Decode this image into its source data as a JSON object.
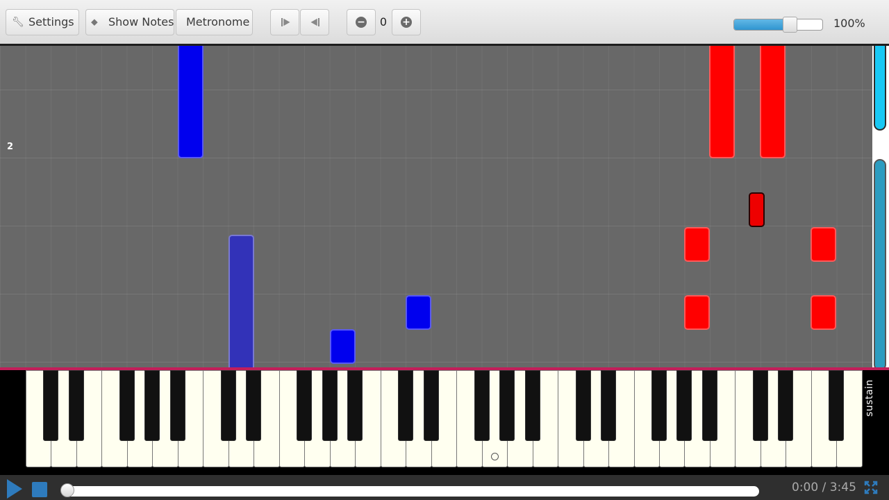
{
  "toolbar": {
    "settings_label": "Settings",
    "show_notes_label": "Show Notes",
    "metronome_label": "Metronome",
    "transpose_value": "0",
    "speed_value": "100%",
    "speed_level": 0.63
  },
  "roll": {
    "measure_number": "2"
  },
  "keyboard": {
    "sustain_label": "sustain"
  },
  "transport": {
    "time_current": "0:00",
    "time_separator": "/",
    "time_total": "3:45",
    "progress": 0
  },
  "colors": {
    "left_hand_notes": "#0000ee",
    "right_hand_notes": "#ff0000",
    "accent": "#2f95d0",
    "keyboard_line": "#c31e5a"
  },
  "icons": {
    "settings": "wrench-icon",
    "show_notes": "tag-icon",
    "rewind": "skip-to-start-icon",
    "forward": "skip-to-end-icon",
    "transpose_down": "minus-circle-icon",
    "transpose_up": "plus-circle-icon",
    "play": "play-icon",
    "stop": "stop-icon",
    "fullscreen": "fullscreen-icon"
  }
}
